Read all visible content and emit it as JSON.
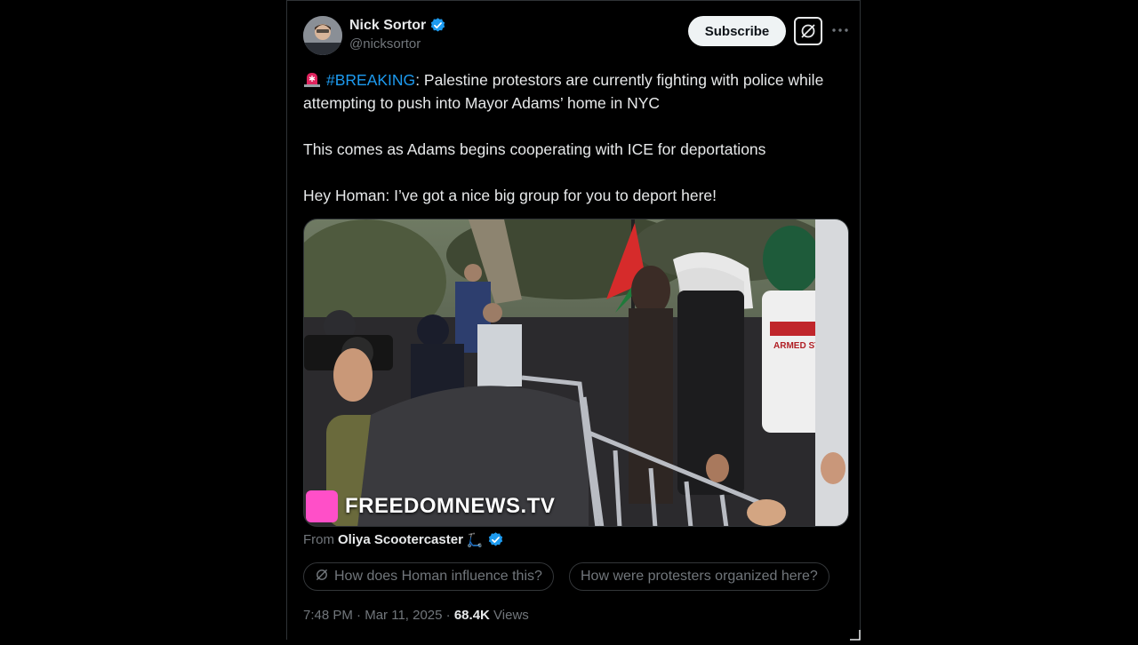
{
  "author": {
    "name": "Nick Sortor",
    "handle": "@nicksortor"
  },
  "actions": {
    "subscribe_label": "Subscribe"
  },
  "post": {
    "hashtag": "#BREAKING",
    "line1_rest": ": Palestine protestors are currently fighting with police while attempting to push into Mayor Adams’ home in NYC",
    "line2": "This comes as Adams begins cooperating with ICE for deportations",
    "line3": "Hey Homan: I’ve got a nice big group for you to deport here!"
  },
  "media": {
    "watermark": "FREEDOMNEWS.TV",
    "banner_text": "ARMED STRUG"
  },
  "source": {
    "prefix": "From",
    "name": "Oliya Scootercaster",
    "emoji": "🛴"
  },
  "grok_prompts": [
    "How does Homan influence this?",
    "How were protesters organized here?"
  ],
  "meta": {
    "time": "7:48 PM",
    "date": "Mar 11, 2025",
    "separator": "·",
    "views_count": "68.4K",
    "views_label": "Views"
  },
  "colors": {
    "background": "#000000",
    "text": "#e7e9ea",
    "muted": "#71767b",
    "link": "#1d9bf0",
    "verified": "#1d9bf0",
    "watermark_logo": "#ff4fc8"
  }
}
